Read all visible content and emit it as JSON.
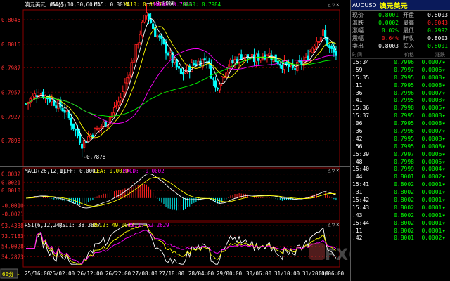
{
  "window": {
    "title_symbol": "澳元美元",
    "timeframe": "(60分)",
    "period_button": "60分"
  },
  "ma_legend": {
    "label": "MA(5,10,30,60)",
    "ma5": "MA5: 0.8014",
    "ma10": "MA10: 0.8017",
    "ma30": "MA30: 0.7993",
    "ma60": "MA60: 0.7984"
  },
  "macd_legend": {
    "label": "MACD(26,12,9)",
    "diff": "DIFF: 0.0009",
    "dea": "DEA: 0.0010",
    "macd": "MACD: -0.0002"
  },
  "rsi_legend": {
    "label": "RSI(6,12,24)",
    "rsi1": "RSI1: 38.3857",
    "rsi2": "RSI2: 49.0047",
    "rsi3": "RSI3: 52.2629"
  },
  "price_axis": [
    "0.8046",
    "0.8016",
    "0.7987",
    "0.7957",
    "0.7927",
    "0.7898"
  ],
  "macd_axis": [
    "0.0032",
    "0.0021",
    "0.0010",
    "-0.0010",
    "-0.0021"
  ],
  "rsi_axis": [
    "93.4338",
    "73.7183",
    "54.0028",
    "34.2873"
  ],
  "time_axis": [
    "25/16:00",
    "26/02:00",
    "26/12:00",
    "26/22:00",
    "27/08:00",
    "27/18:00",
    "28/04:00",
    "29/00:00",
    "30/06:00",
    "31/10:00",
    "31/20:00",
    "01/06:00"
  ],
  "annotations": {
    "high": "0.8066",
    "low": "0.7878"
  },
  "colors": {
    "up": "#ff2020",
    "down": "#00ffff",
    "ma5": "#ffffff",
    "ma10": "#ffff00",
    "ma30": "#ff00ff",
    "ma60": "#00ff00"
  },
  "quote_panel": {
    "code": "AUDUSD",
    "name": "澳元美元",
    "rows": [
      {
        "k1": "现价",
        "v1": "0.8001",
        "c1": "green",
        "k2": "开盘",
        "v2": "0.8003",
        "c2": "white"
      },
      {
        "k1": "涨跌",
        "v1": "0.0002",
        "c1": "green",
        "k2": "最高",
        "v2": "0.8043",
        "c2": "red"
      },
      {
        "k1": "涨幅",
        "v1": "0.02%",
        "c1": "green",
        "k2": "最低",
        "v2": "0.7992",
        "c2": "green"
      },
      {
        "k1": "震幅",
        "v1": "0.64%",
        "c1": "red",
        "k2": "昨收",
        "v2": "0.8003",
        "c2": "white"
      },
      {
        "k1": "卖出",
        "v1": "0.8003",
        "c1": "white",
        "k2": "买入",
        "v2": "0.8001",
        "c2": "green"
      }
    ]
  },
  "tick_header": {
    "time": "时间",
    "price": "价格",
    "change": "涨跌"
  },
  "ticks": [
    {
      "t": "15:34",
      "p": "0.7996",
      "d": "0.0007"
    },
    {
      "t": ".59",
      "p": "0.7997",
      "d": "0.0006"
    },
    {
      "t": "15:35",
      "p": "0.7995",
      "d": "0.0008"
    },
    {
      "t": ".11",
      "p": "0.7995",
      "d": "0.0008"
    },
    {
      "t": ".36",
      "p": "0.7996",
      "d": "0.0007"
    },
    {
      "t": ".41",
      "p": "0.7995",
      "d": "0.0008"
    },
    {
      "t": "15:36",
      "p": "0.7998",
      "d": "0.0005"
    },
    {
      "t": "15:37",
      "p": "0.7995",
      "d": "0.0008"
    },
    {
      "t": ".06",
      "p": "0.7995",
      "d": "0.0008"
    },
    {
      "t": ".36",
      "p": "0.7996",
      "d": "0.0007"
    },
    {
      "t": ".42",
      "p": "0.7995",
      "d": "0.0008"
    },
    {
      "t": ".56",
      "p": "0.7995",
      "d": "0.0008"
    },
    {
      "t": "15:39",
      "p": "0.7997",
      "d": "0.0006"
    },
    {
      "t": ".48",
      "p": "0.7998",
      "d": "0.0005"
    },
    {
      "t": "15:40",
      "p": "0.7999",
      "d": "0.0004"
    },
    {
      "t": ".44",
      "p": "0.8001",
      "d": "0.0002"
    },
    {
      "t": "15:41",
      "p": "0.8002",
      "d": "0.0001"
    },
    {
      "t": ".31",
      "p": "0.8002",
      "d": "0.0001"
    },
    {
      "t": "15:42",
      "p": "0.8002",
      "d": "0.0001"
    },
    {
      "t": "15:43",
      "p": "0.8002",
      "d": "0.0001"
    },
    {
      "t": ".43",
      "p": "0.8002",
      "d": "0.0001"
    },
    {
      "t": "15:44",
      "p": "0.8002",
      "d": "0.0001"
    },
    {
      "t": ".11",
      "p": "0.8002",
      "d": "0.0001"
    },
    {
      "t": ".42",
      "p": "0.8001",
      "d": "0.0002"
    }
  ],
  "watermark": "FX678 汇通网"
}
